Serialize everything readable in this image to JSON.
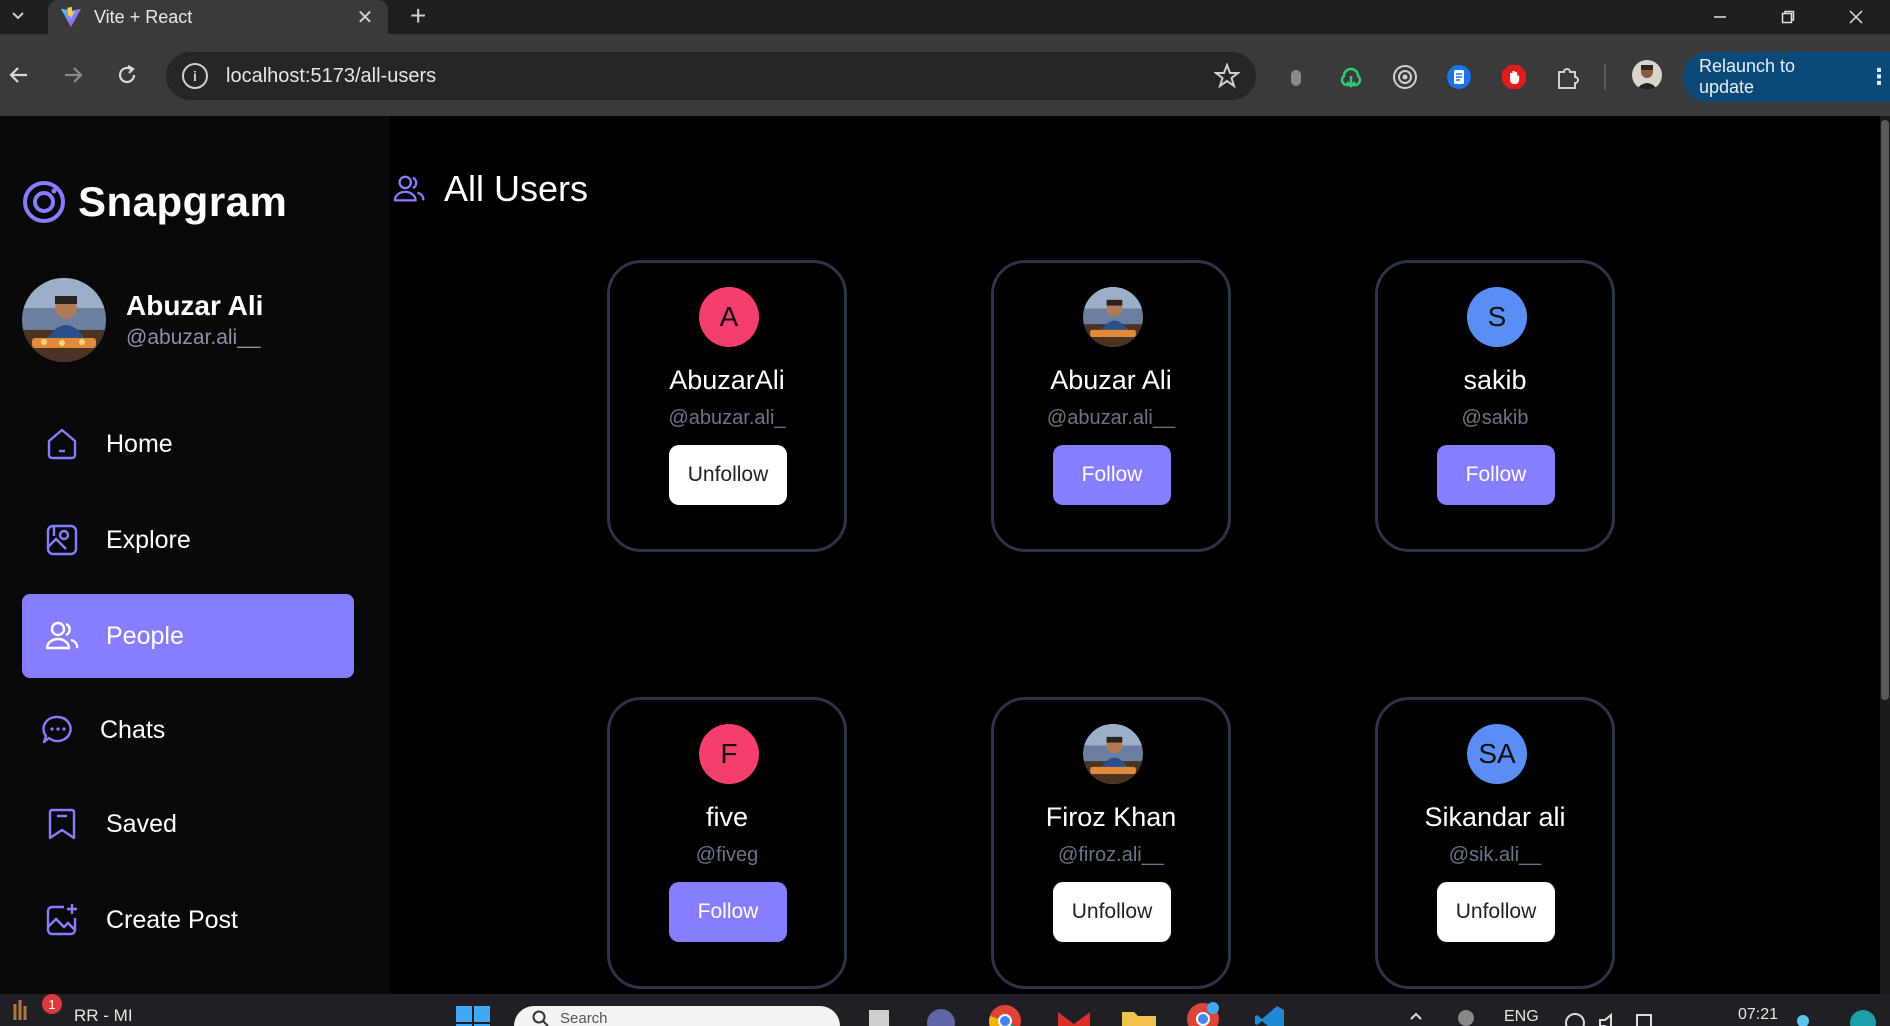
{
  "browser": {
    "tab_title": "Vite + React",
    "url": "localhost:5173/all-users",
    "relaunch_label": "Relaunch to update"
  },
  "app": {
    "brand": "Snapgram",
    "profile": {
      "name": "Abuzar Ali",
      "handle": "@abuzar.ali__"
    },
    "nav": [
      {
        "label": "Home",
        "icon": "home-icon",
        "active": false
      },
      {
        "label": "Explore",
        "icon": "explore-icon",
        "active": false
      },
      {
        "label": "People",
        "icon": "people-icon",
        "active": true
      },
      {
        "label": "Chats",
        "icon": "chat-icon",
        "active": false
      },
      {
        "label": "Saved",
        "icon": "bookmark-icon",
        "active": false
      },
      {
        "label": "Create Post",
        "icon": "create-post-icon",
        "active": false
      }
    ],
    "page_title": "All Users",
    "users": [
      {
        "initials": "A",
        "avatar_color": "#f43f6e",
        "photo": false,
        "name": "AbuzarAli",
        "handle": "@abuzar.ali_",
        "action": "Unfollow"
      },
      {
        "initials": "",
        "avatar_color": "",
        "photo": true,
        "name": "Abuzar Ali",
        "handle": "@abuzar.ali__",
        "action": "Follow"
      },
      {
        "initials": "S",
        "avatar_color": "#5b8ef5",
        "photo": false,
        "name": "sakib",
        "handle": "@sakib",
        "action": "Follow"
      },
      {
        "initials": "F",
        "avatar_color": "#f43f6e",
        "photo": false,
        "name": "five",
        "handle": "@fiveg",
        "action": "Follow"
      },
      {
        "initials": "",
        "avatar_color": "",
        "photo": true,
        "name": "Firoz Khan",
        "handle": "@firoz.ali__",
        "action": "Unfollow"
      },
      {
        "initials": "SA",
        "avatar_color": "#5b8ef5",
        "photo": false,
        "name": "Sikandar ali",
        "handle": "@sik.ali__",
        "action": "Unfollow"
      }
    ]
  },
  "taskbar": {
    "notification_count": "1",
    "app_label": "RR - MI",
    "search_placeholder": "Search",
    "language": "ENG",
    "time": "07:21"
  },
  "colors": {
    "accent": "#877eff",
    "card_border": "#2d3448",
    "browser_toolbar": "#3a3a3a",
    "relaunch": "#0b4a78"
  }
}
